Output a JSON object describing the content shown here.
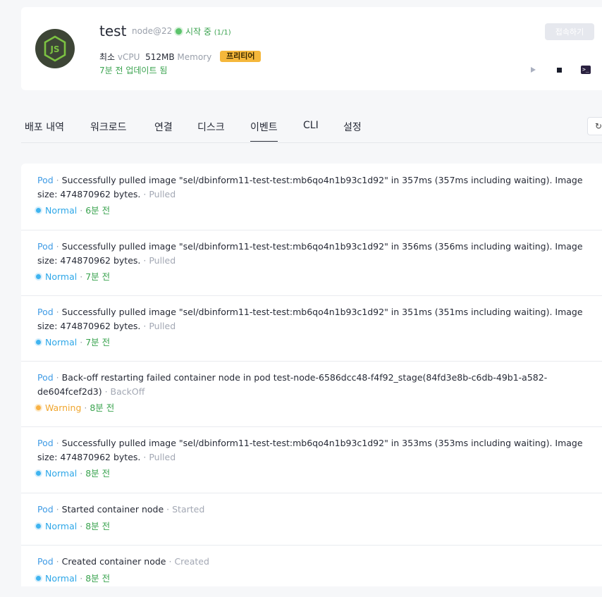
{
  "app": {
    "name": "test",
    "runtime": "node@22",
    "status": "시작 중",
    "status_count": "(1/1)",
    "cpu_label": "최소",
    "cpu_unit": "vCPU",
    "memory_value": "512MB",
    "memory_unit": "Memory",
    "tier": "프리티어",
    "updated": "7분 전 업데이트 됨",
    "connect_label": "접속하기",
    "logo_text": "JS"
  },
  "colors": {
    "accent_blue": "#3f9be5",
    "status_green": "#3aa34f",
    "warning_orange": "#f0a62e",
    "badge_yellow": "#f5b73b"
  },
  "icons": [
    "nodejs-logo-icon",
    "play-icon",
    "stop-icon",
    "terminal-icon",
    "refresh-icon"
  ],
  "tabs": [
    {
      "label": "배포 내역"
    },
    {
      "label": "워크로드"
    },
    {
      "label": "연결"
    },
    {
      "label": "디스크"
    },
    {
      "label": "이벤트",
      "active": true
    },
    {
      "label": "CLI"
    },
    {
      "label": "설정"
    }
  ],
  "events": [
    {
      "kind": "Pod",
      "message": "Successfully pulled image \"sel/dbinform11-test-test:mb6qo4n1b93c1d92\" in 357ms (357ms including waiting). Image size: 474870962 bytes.",
      "reason": "Pulled",
      "type": "Normal",
      "time": "6분 전"
    },
    {
      "kind": "Pod",
      "message": "Successfully pulled image \"sel/dbinform11-test-test:mb6qo4n1b93c1d92\" in 356ms (356ms including waiting). Image size: 474870962 bytes.",
      "reason": "Pulled",
      "type": "Normal",
      "time": "7분 전"
    },
    {
      "kind": "Pod",
      "message": "Successfully pulled image \"sel/dbinform11-test-test:mb6qo4n1b93c1d92\" in 351ms (351ms including waiting). Image size: 474870962 bytes.",
      "reason": "Pulled",
      "type": "Normal",
      "time": "7분 전"
    },
    {
      "kind": "Pod",
      "message": "Back-off restarting failed container node in pod test-node-6586dcc48-f4f92_stage(84fd3e8b-c6db-49b1-a582-de604fcef2d3)",
      "reason": "BackOff",
      "type": "Warning",
      "time": "8분 전"
    },
    {
      "kind": "Pod",
      "message": "Successfully pulled image \"sel/dbinform11-test-test:mb6qo4n1b93c1d92\" in 353ms (353ms including waiting). Image size: 474870962 bytes.",
      "reason": "Pulled",
      "type": "Normal",
      "time": "8분 전"
    },
    {
      "kind": "Pod",
      "message": "Started container node",
      "reason": "Started",
      "type": "Normal",
      "time": "8분 전"
    },
    {
      "kind": "Pod",
      "message": "Created container node",
      "reason": "Created",
      "type": "Normal",
      "time": "8분 전"
    }
  ]
}
